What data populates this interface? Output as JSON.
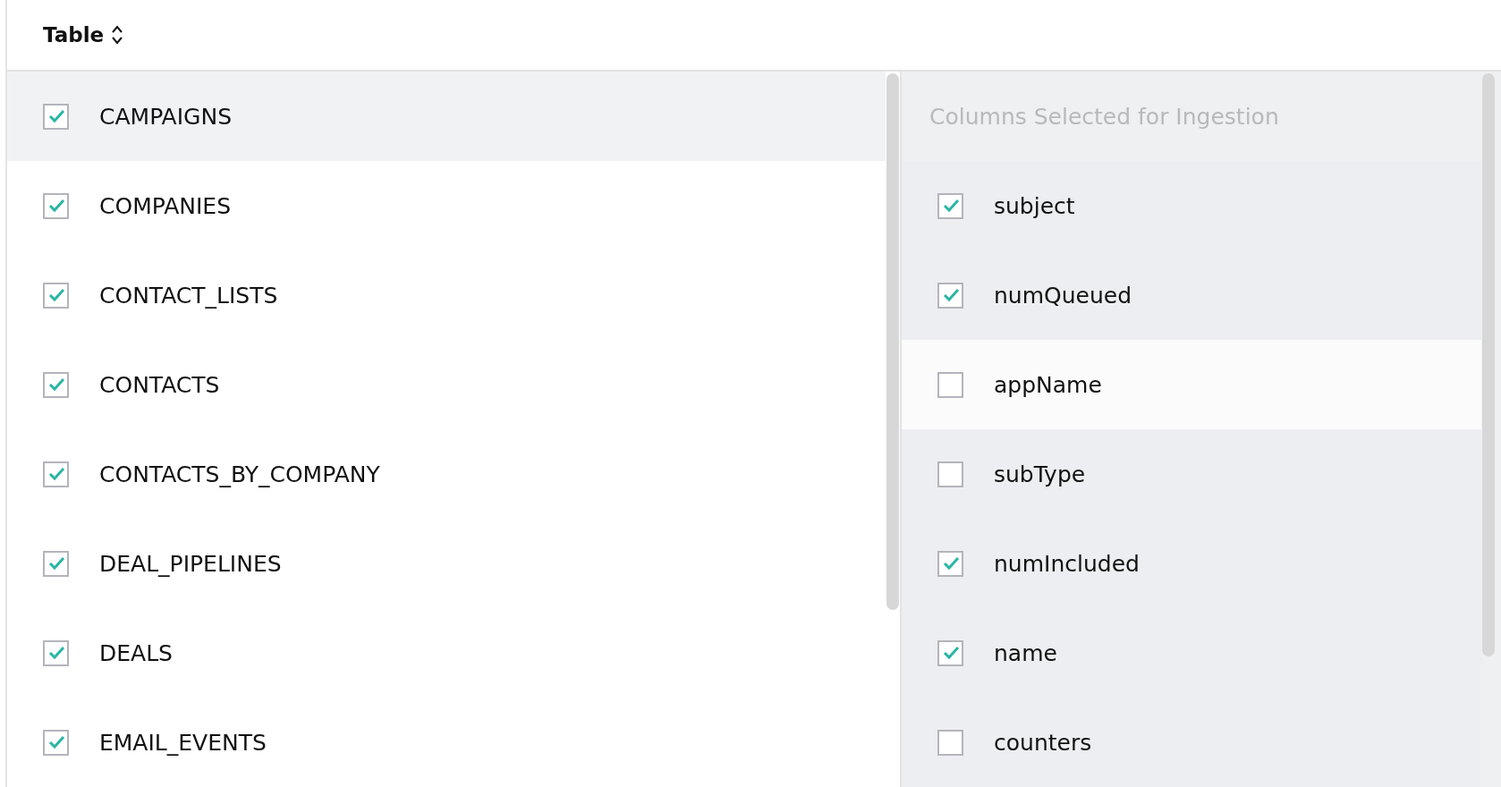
{
  "header": {
    "title": "Table"
  },
  "tables": [
    {
      "name": "CAMPAIGNS",
      "checked": true,
      "selected": true
    },
    {
      "name": "COMPANIES",
      "checked": true,
      "selected": false
    },
    {
      "name": "CONTACT_LISTS",
      "checked": true,
      "selected": false
    },
    {
      "name": "CONTACTS",
      "checked": true,
      "selected": false
    },
    {
      "name": "CONTACTS_BY_COMPANY",
      "checked": true,
      "selected": false
    },
    {
      "name": "DEAL_PIPELINES",
      "checked": true,
      "selected": false
    },
    {
      "name": "DEALS",
      "checked": true,
      "selected": false
    },
    {
      "name": "EMAIL_EVENTS",
      "checked": true,
      "selected": false
    }
  ],
  "columns_panel": {
    "title": "Columns Selected for Ingestion",
    "columns": [
      {
        "name": "subject",
        "checked": true,
        "selected": false
      },
      {
        "name": "numQueued",
        "checked": true,
        "selected": false
      },
      {
        "name": "appName",
        "checked": false,
        "selected": true
      },
      {
        "name": "subType",
        "checked": false,
        "selected": false
      },
      {
        "name": "numIncluded",
        "checked": true,
        "selected": false
      },
      {
        "name": "name",
        "checked": true,
        "selected": false
      },
      {
        "name": "counters",
        "checked": false,
        "selected": false
      }
    ]
  }
}
